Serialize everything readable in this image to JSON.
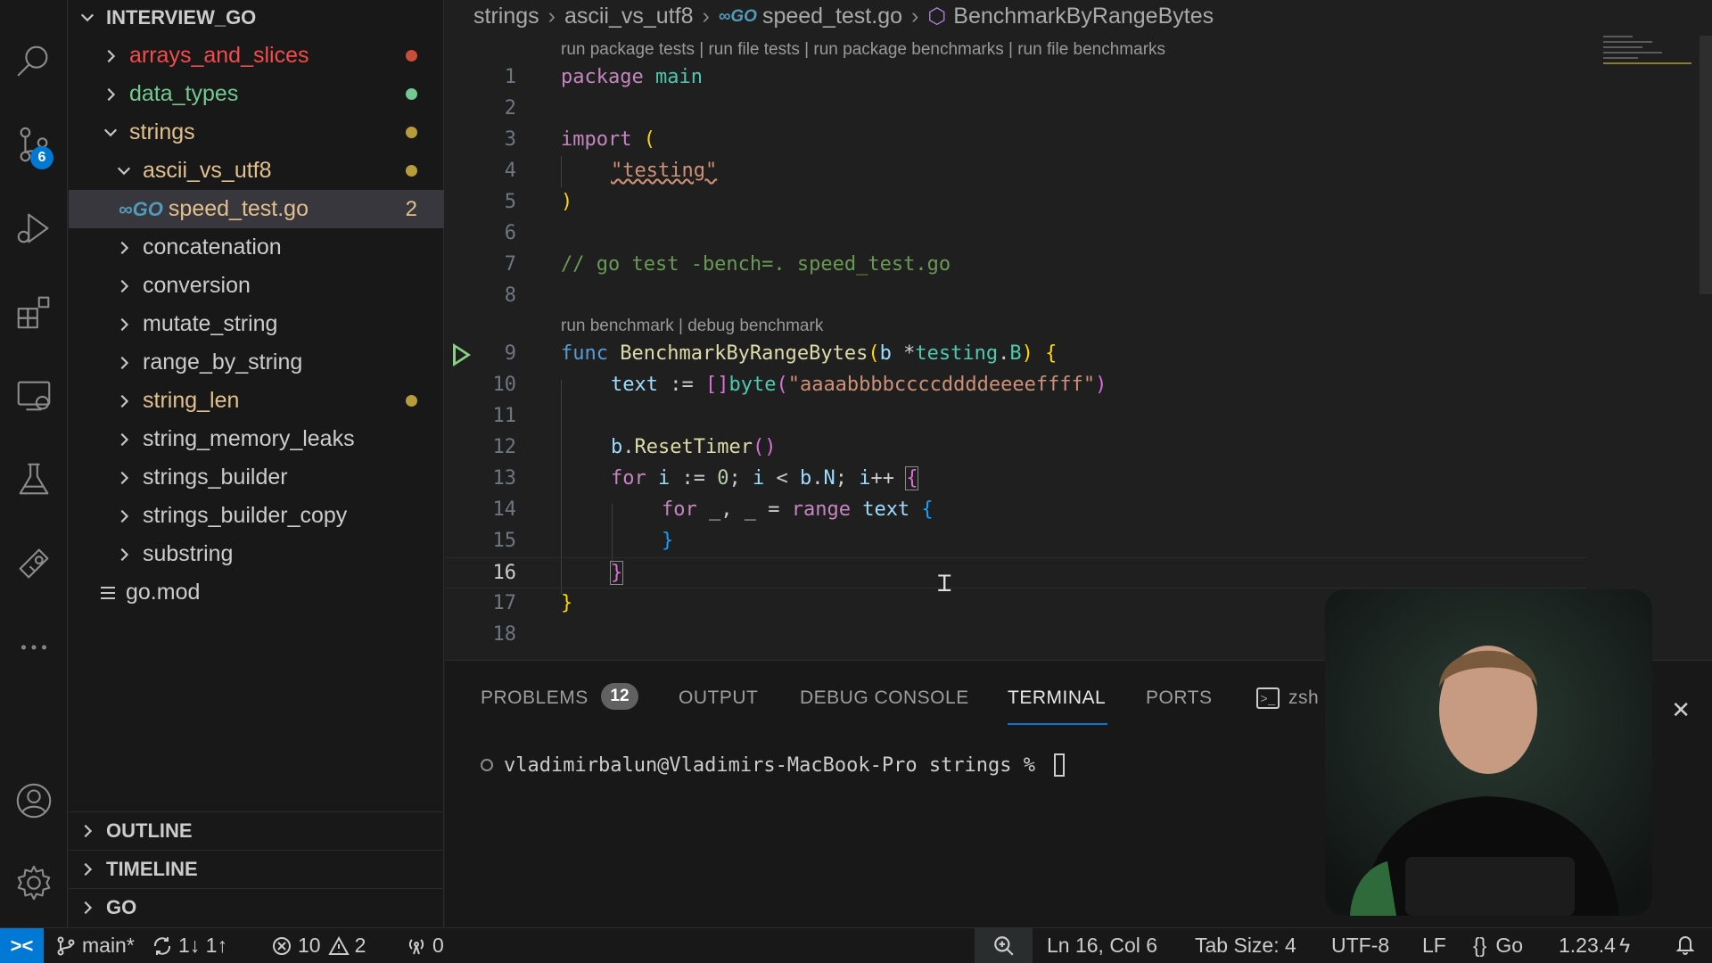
{
  "activity_bar": {
    "source_control_badge": "6"
  },
  "explorer": {
    "root": "INTERVIEW_GO",
    "items": [
      {
        "label": "arrays_and_slices",
        "color": "#f14c4c",
        "decoration": "dot",
        "decoration_color": "#c74e39"
      },
      {
        "label": "data_types",
        "color": "#73c991",
        "decoration": "dot",
        "decoration_color": "#73c991"
      },
      {
        "label": "strings",
        "color": "#e2c08d",
        "decoration": "dot",
        "decoration_color": "#e2c08d"
      },
      {
        "label": "ascii_vs_utf8",
        "color": "#e2c08d",
        "decoration": "dot",
        "decoration_color": "#e2c08d"
      },
      {
        "label": "speed_test.go",
        "color": "#e2c08d",
        "badge": "GO",
        "count": "2"
      },
      {
        "label": "concatenation"
      },
      {
        "label": "conversion"
      },
      {
        "label": "mutate_string"
      },
      {
        "label": "range_by_string"
      },
      {
        "label": "string_len",
        "color": "#e2c08d",
        "decoration": "dot",
        "decoration_color": "#e2c08d"
      },
      {
        "label": "string_memory_leaks"
      },
      {
        "label": "strings_builder"
      },
      {
        "label": "strings_builder_copy"
      },
      {
        "label": "substring"
      },
      {
        "label": "go.mod"
      }
    ],
    "sections": [
      "OUTLINE",
      "TIMELINE",
      "GO"
    ]
  },
  "editor": {
    "breadcrumb": [
      "strings",
      "ascii_vs_utf8",
      "speed_test.go",
      "BenchmarkByRangeBytes"
    ],
    "code_lens_top": "run package tests | run file tests | run package benchmarks | run file benchmarks",
    "code_lens_func": "run benchmark | debug benchmark",
    "line_numbers": [
      "1",
      "2",
      "3",
      "4",
      "5",
      "6",
      "7",
      "8",
      "9",
      "10",
      "11",
      "12",
      "13",
      "14",
      "15",
      "16",
      "17",
      "18"
    ],
    "active_line": "16",
    "code": {
      "l1_kw": "package",
      "l1_name": "main",
      "l3_kw": "import",
      "l3_paren": "(",
      "l4_str": "\"testing\"",
      "l5_paren": ")",
      "l7_comment": "// go test -bench=. speed_test.go",
      "l9_kw": "func",
      "l9_fn": "BenchmarkByRangeBytes",
      "l9_open": "(",
      "l9_param": "b",
      "l9_star": " *",
      "l9_pkg": "testing",
      "l9_dot": ".",
      "l9_type": "B",
      "l9_close": ")",
      "l9_brace": " {",
      "l10_var": "text",
      "l10_op": " := ",
      "l10_br": "[]",
      "l10_type": "byte",
      "l10_open": "(",
      "l10_str": "\"aaaabbbbccccddddeeeeffff\"",
      "l10_close": ")",
      "l12_obj": "b",
      "l12_dot": ".",
      "l12_fn": "ResetTimer",
      "l12_paren": "()",
      "l13_for": "for",
      "l13_i": " i",
      "l13_op": " := ",
      "l13_num": "0",
      "l13_mid": "; ",
      "l13_i2": "i",
      "l13_lt": " < ",
      "l13_b": "b",
      "l13_dot": ".",
      "l13_n": "N",
      "l13_semi": "; ",
      "l13_i3": "i",
      "l13_inc": "++ ",
      "l13_brace": "{",
      "l14_for": "for",
      "l14_rest": " _, _ = ",
      "l14_range": "range",
      "l14_text": " text",
      "l14_brace": " {",
      "l15_brace": "}",
      "l16_brace": "}",
      "l17_brace": "}"
    }
  },
  "panel": {
    "tabs": [
      "PROBLEMS",
      "OUTPUT",
      "DEBUG CONSOLE",
      "TERMINAL",
      "PORTS"
    ],
    "problems_count": "12",
    "active_tab": "TERMINAL",
    "shell": "zsh",
    "prompt": "vladimirbalun@Vladimirs-MacBook-Pro strings % "
  },
  "status_bar": {
    "branch": "main*",
    "sync": "1↓ 1↑",
    "errors": "10",
    "warnings": "2",
    "ports": "0",
    "position": "Ln 16, Col 6",
    "tab_size": "Tab Size: 4",
    "encoding": "UTF-8",
    "eol": "LF",
    "language": "Go",
    "go_version": "1.23.4"
  },
  "colors": {
    "accent": "#0078d4",
    "editor_bg": "#1f1f1f",
    "sidebar_bg": "#181818",
    "run_icon": "#89d185"
  }
}
